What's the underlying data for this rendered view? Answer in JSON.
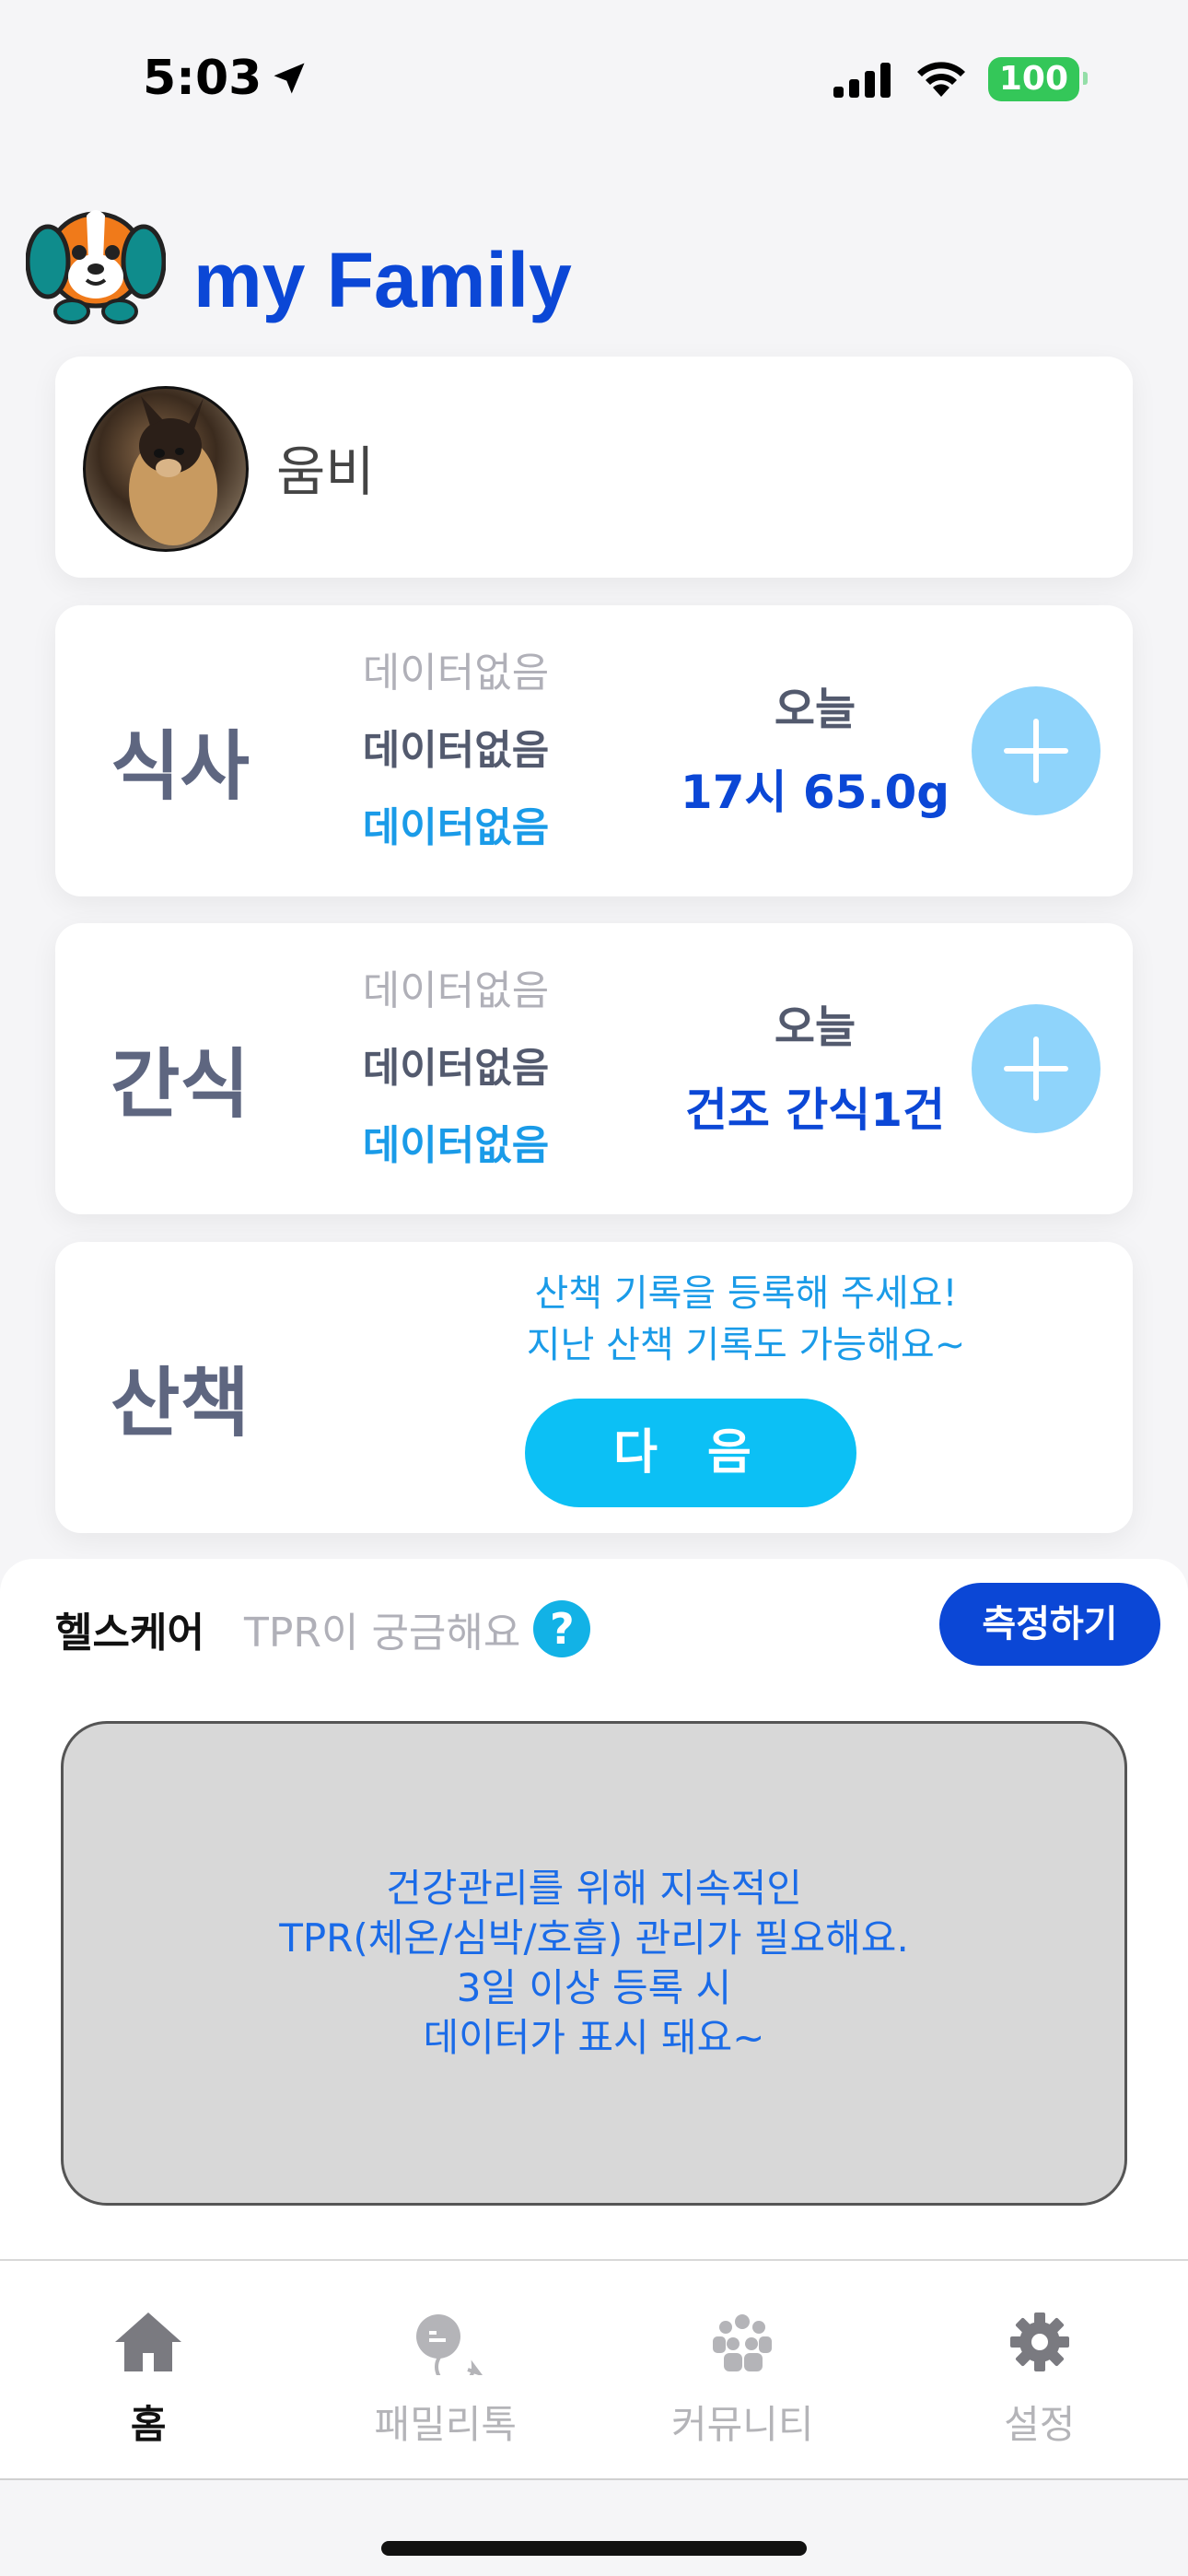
{
  "status_bar": {
    "time": "5:03",
    "battery": "100"
  },
  "header": {
    "title": "my Family"
  },
  "pet": {
    "name": "움비"
  },
  "meal": {
    "label": "식사",
    "rows": [
      "데이터없음",
      "데이터없음",
      "데이터없음"
    ],
    "today_label": "오늘",
    "today_value": "17시 65.0g"
  },
  "snack": {
    "label": "간식",
    "rows": [
      "데이터없음",
      "데이터없음",
      "데이터없음"
    ],
    "today_label": "오늘",
    "today_value": "건조 간식1건"
  },
  "walk": {
    "label": "산책",
    "message_line1": "산책 기록을 등록해 주세요!",
    "message_line2": "지난 산책 기록도 가능해요~",
    "next_button": "다 음"
  },
  "healthcare": {
    "title": "헬스케어",
    "question": "TPR이 궁금해요",
    "question_icon": "?",
    "measure_button": "측정하기",
    "chart_message": [
      "건강관리를 위해 지속적인",
      "TPR(체온/심박/호흡) 관리가 필요해요.",
      "3일 이상 등록 시",
      "데이터가 표시 돼요~"
    ]
  },
  "tabs": [
    {
      "label": "홈",
      "icon": "home-icon",
      "active": true
    },
    {
      "label": "패밀리톡",
      "icon": "chat-icon",
      "active": false
    },
    {
      "label": "커뮤니티",
      "icon": "community-icon",
      "active": false
    },
    {
      "label": "설정",
      "icon": "gear-icon",
      "active": false
    }
  ],
  "colors": {
    "brand": "#0b47d6",
    "accent": "#0cc0f5",
    "plus": "#8fd4fb"
  }
}
